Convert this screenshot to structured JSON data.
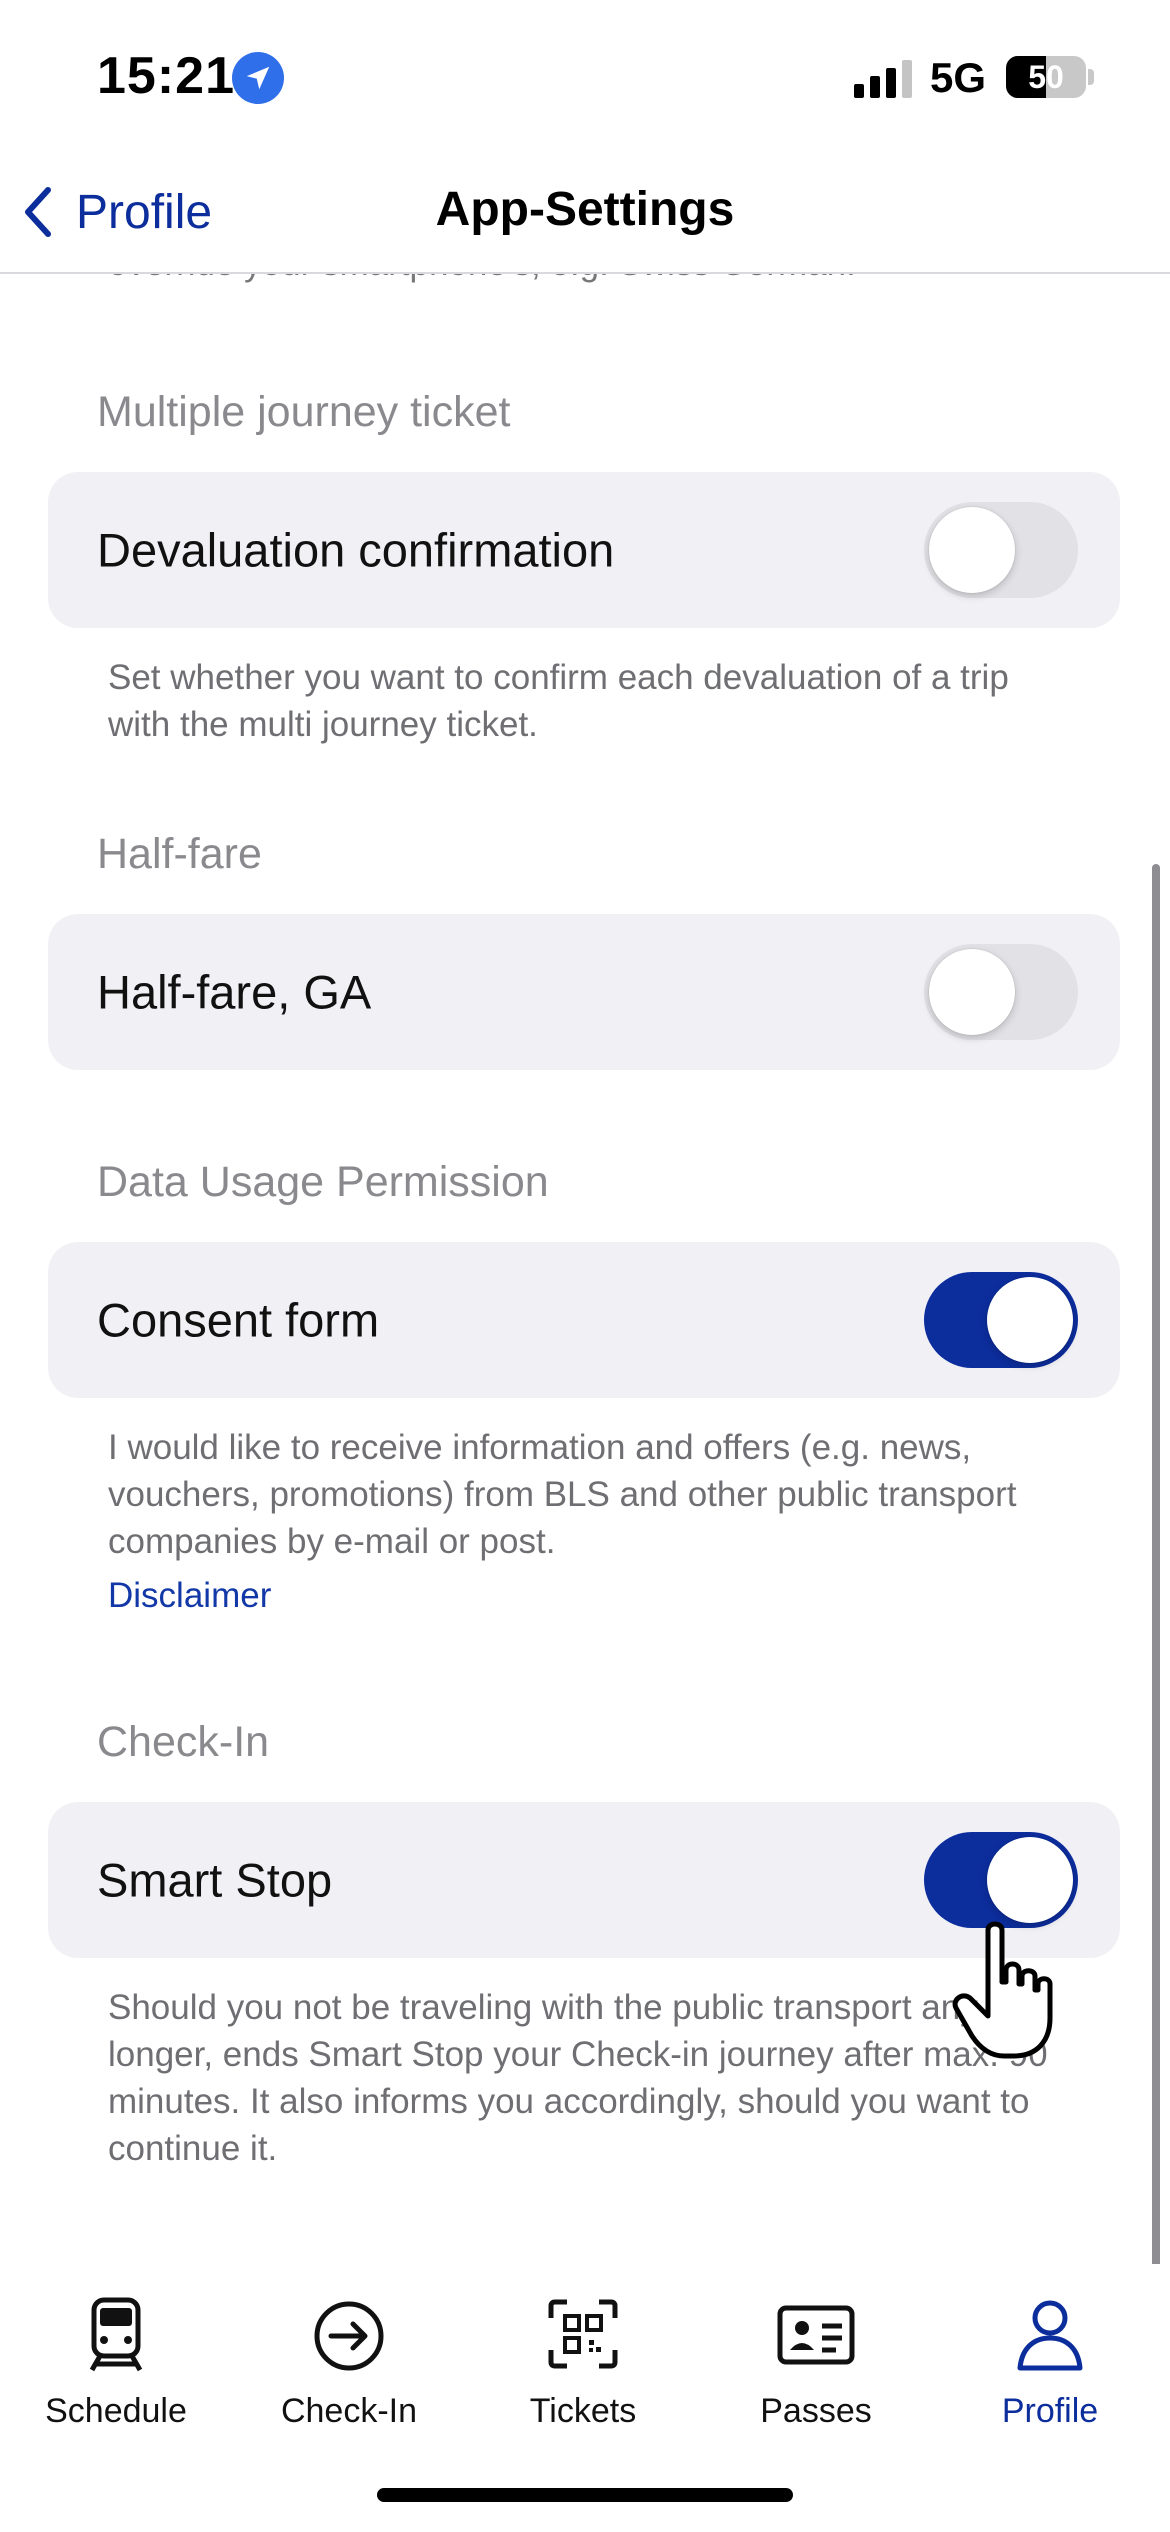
{
  "status_bar": {
    "time": "15:21",
    "network": "5G",
    "battery_percent": "50",
    "battery_level": 0.5
  },
  "nav": {
    "back_label": "Profile",
    "title": "App-Settings"
  },
  "content": {
    "clipped_text": "override your smartphone's, e.g. Swiss German.",
    "sections": [
      {
        "title": "Multiple journey ticket",
        "setting_label": "Devaluation confirmation",
        "enabled": false,
        "description": "Set whether you want to confirm each devaluation of a trip with the multi journey ticket."
      },
      {
        "title": "Half-fare",
        "setting_label": "Half-fare, GA",
        "enabled": false
      },
      {
        "title": "Data Usage Permission",
        "setting_label": "Consent form",
        "enabled": true,
        "description": "I would like to receive information and offers (e.g. news, vouchers, promotions) from BLS and other public transport companies by e-mail or post.",
        "link": "Disclaimer"
      },
      {
        "title": "Check-In",
        "setting_label": "Smart Stop",
        "enabled": true,
        "description": "Should you not be traveling with the public transport any longer, ends Smart Stop your Check-in journey after max. 90 minutes. It also informs you accordingly, should you want to continue it."
      }
    ]
  },
  "tab_bar": {
    "tabs": [
      {
        "label": "Schedule",
        "icon": "train-icon"
      },
      {
        "label": "Check-In",
        "icon": "arrow-circle-icon"
      },
      {
        "label": "Tickets",
        "icon": "qr-code-icon"
      },
      {
        "label": "Passes",
        "icon": "id-card-icon"
      },
      {
        "label": "Profile",
        "icon": "person-icon",
        "active": true
      }
    ]
  },
  "colors": {
    "accent": "#0c2d9c",
    "card_background": "#f0f0f5",
    "toggle_off": "#e1e1e6",
    "secondary_text": "#8a8a8e"
  }
}
